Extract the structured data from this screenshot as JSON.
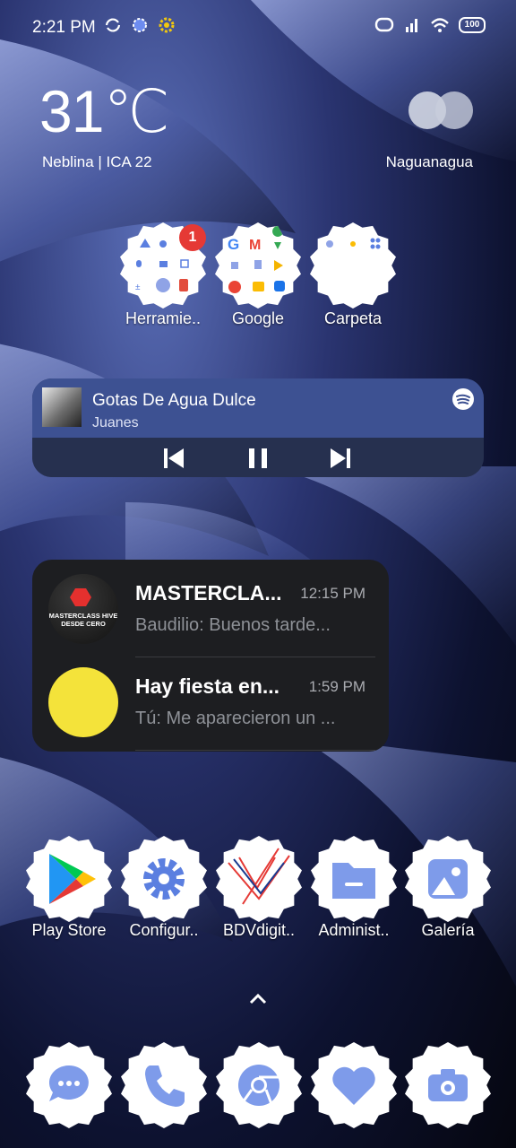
{
  "status_bar": {
    "time": "2:21 PM",
    "battery": "100"
  },
  "weather": {
    "temperature": "31℃",
    "condition": "Neblina | ICA 22",
    "location": "Naguanagua"
  },
  "folders": [
    {
      "label": "Herramie..",
      "badge": "1"
    },
    {
      "label": "Google"
    },
    {
      "label": "Carpeta"
    }
  ],
  "music": {
    "song": "Gotas De Agua Dulce",
    "artist": "Juanes"
  },
  "chats": [
    {
      "title": "MASTERCLA...",
      "time": "12:15 PM",
      "message": "Baudilio: Buenos tarde...",
      "avatar_text": "MASTERCLASS HIVE DESDE CERO"
    },
    {
      "title": "Hay fiesta en...",
      "time": "1:59 PM",
      "message": "Tú: Me aparecieron un ..."
    }
  ],
  "apps": [
    {
      "label": "Play Store",
      "icon": "play-store-icon"
    },
    {
      "label": "Configur..",
      "icon": "gear-icon"
    },
    {
      "label": "BDVdigit..",
      "icon": "bdv-icon"
    },
    {
      "label": "Administ..",
      "icon": "folder-icon"
    },
    {
      "label": "Galería",
      "icon": "gallery-icon"
    }
  ],
  "dock": [
    {
      "icon": "messages-icon"
    },
    {
      "icon": "phone-icon"
    },
    {
      "icon": "chrome-icon"
    },
    {
      "icon": "heart-icon"
    },
    {
      "icon": "camera-icon"
    }
  ],
  "colors": {
    "accent": "#5b7fe0",
    "music_bg": "#3d5192",
    "chat_bg": "#1d1e21"
  }
}
